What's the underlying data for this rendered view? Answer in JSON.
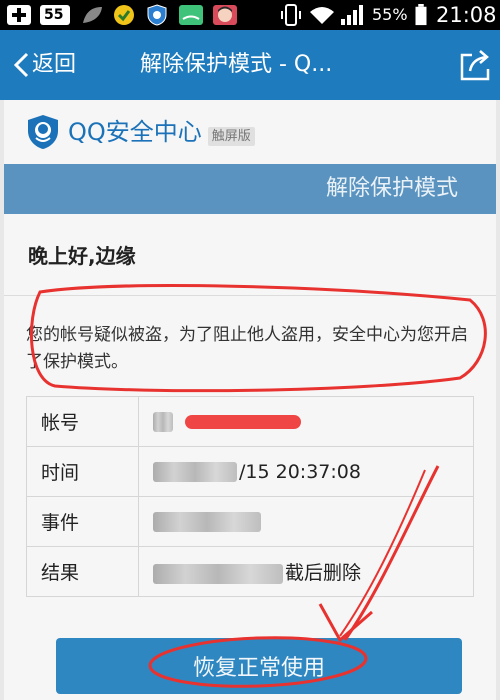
{
  "status_bar": {
    "app_badge": "55",
    "battery": "55%",
    "time": "21:08"
  },
  "nav": {
    "back_label": "返回",
    "title": "解除保护模式 - Q..."
  },
  "brand": {
    "name": "QQ安全中心",
    "badge": "触屏版"
  },
  "section_title": "解除保护模式",
  "greeting": "晚上好,边缘",
  "notice": "您的帐号疑似被盗，为了阻止他人盗用，安全中心为您开启了保护模式。",
  "info_rows": [
    {
      "label": "帐号",
      "value": ""
    },
    {
      "label": "时间",
      "value": "/15  20:37:08"
    },
    {
      "label": "事件",
      "value": ""
    },
    {
      "label": "结果",
      "value": "截后删除"
    }
  ],
  "restore_button": "恢复正常使用",
  "colors": {
    "nav_bg": "#1e7bbd",
    "section_bg": "#5a93bf",
    "button_bg": "#2f87c1",
    "brand_text": "#1b72b8",
    "annotation_red": "#e8322f"
  }
}
